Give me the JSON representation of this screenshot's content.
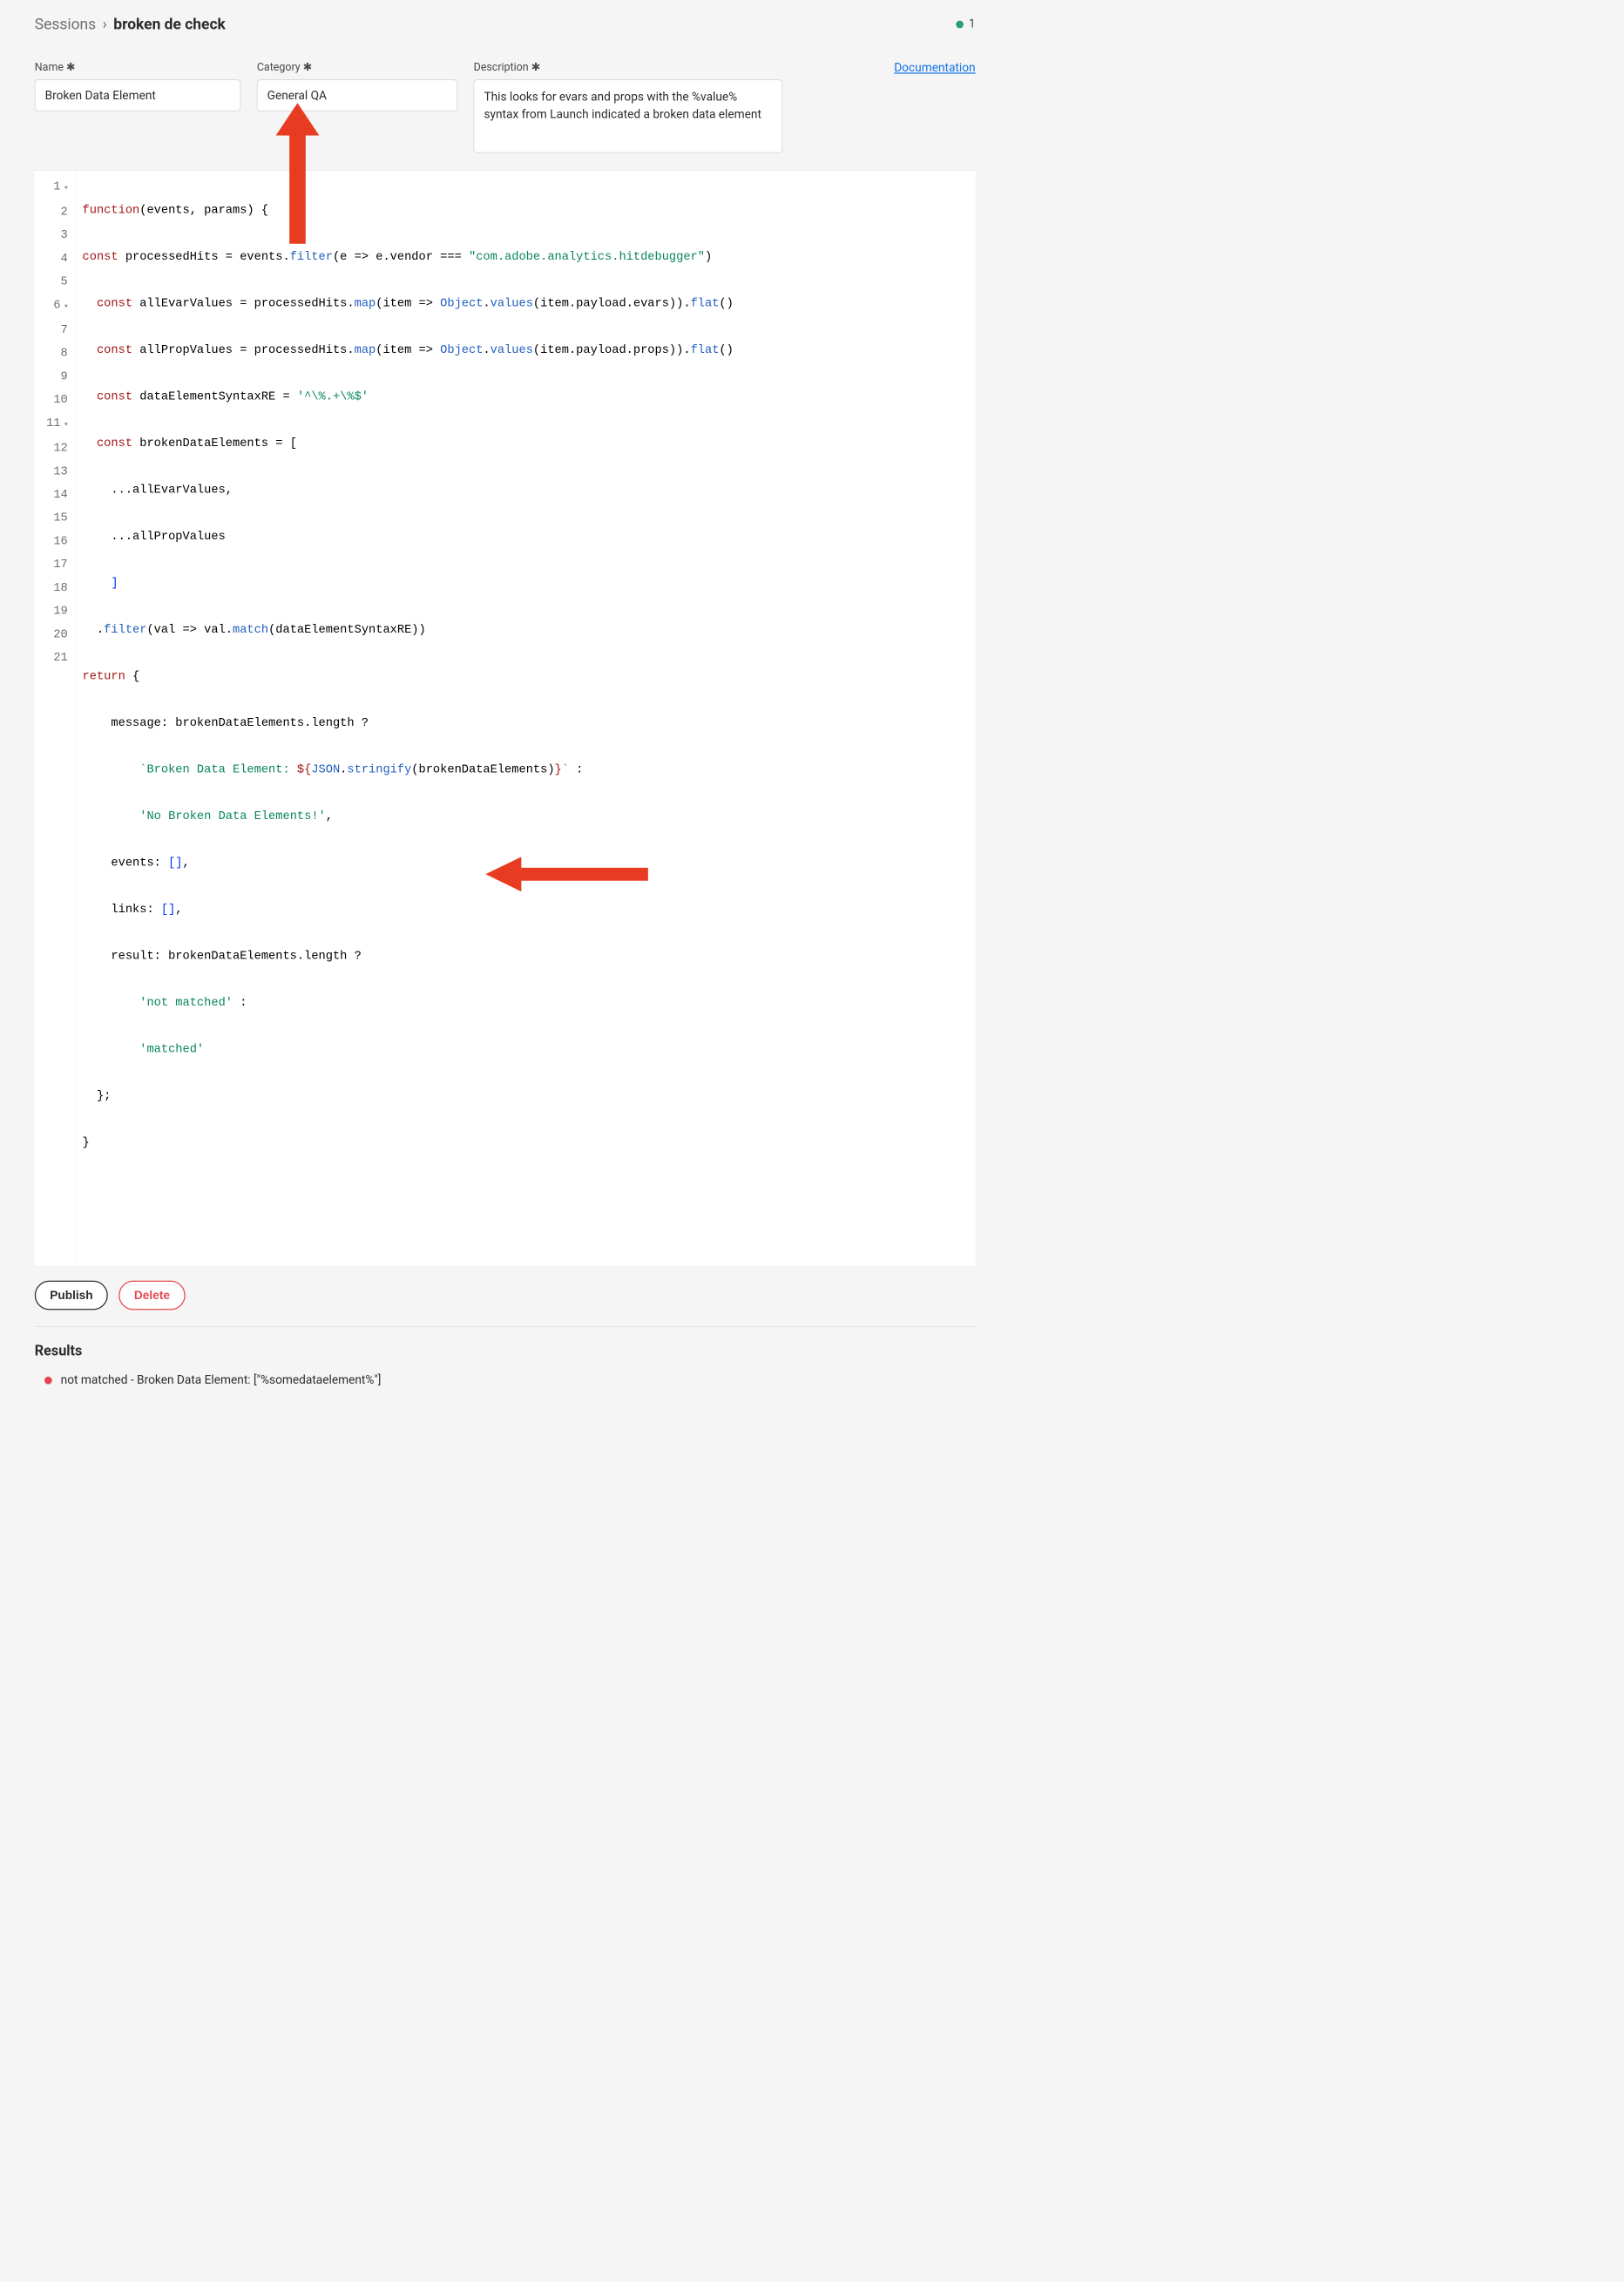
{
  "breadcrumb": {
    "root": "Sessions",
    "sep": "›",
    "current": "broken de check"
  },
  "status": {
    "count": "1"
  },
  "doc_link_label": "Documentation",
  "fields": {
    "name_label": "Name ✱",
    "name_value": "Broken Data Element",
    "category_label": "Category ✱",
    "category_value": "General QA",
    "description_label": "Description ✱",
    "description_value": "This looks for evars and props with the %value% syntax from Launch indicated a broken data element"
  },
  "code": {
    "l1": {
      "a": "function",
      "b": "(events, params) {"
    },
    "l2": {
      "a": "const",
      "b": " processedHits = events.",
      "c": "filter",
      "d": "(e => e.vendor === ",
      "e": "\"com.adobe.analytics.hitdebugger\"",
      "f": ")"
    },
    "l3": {
      "a": "  const",
      "b": " allEvarValues = processedHits.",
      "c": "map",
      "d": "(item => ",
      "e": "Object",
      "f": ".",
      "g": "values",
      "h": "(item.payload.evars)).",
      "i": "flat",
      "j": "()"
    },
    "l4": {
      "a": "  const",
      "b": " allPropValues = processedHits.",
      "c": "map",
      "d": "(item => ",
      "e": "Object",
      "f": ".",
      "g": "values",
      "h": "(item.payload.props)).",
      "i": "flat",
      "j": "()"
    },
    "l5": {
      "a": "  const",
      "b": " dataElementSyntaxRE = ",
      "c": "'^\\%.+\\%$'"
    },
    "l6": {
      "a": "  const",
      "b": " brokenDataElements = ["
    },
    "l7": "    ...allEvarValues,",
    "l8": "    ...allPropValues",
    "l9": "    ]",
    "l10": {
      "a": "  .",
      "b": "filter",
      "c": "(val => val.",
      "d": "match",
      "e": "(dataElementSyntaxRE))"
    },
    "l11": {
      "a": "return",
      "b": " {"
    },
    "l12": "    message: brokenDataElements.length ?",
    "l13": {
      "a": "        `Broken Data Element: ",
      "b": "${",
      "c": "JSON",
      "d": ".",
      "e": "stringify",
      "f": "(brokenDataElements)",
      "g": "}",
      "h": "`",
      "i": " :"
    },
    "l14": {
      "a": "        ",
      "b": "'No Broken Data Elements!'",
      "c": ","
    },
    "l15": {
      "a": "    events: ",
      "b": "[]",
      "c": ","
    },
    "l16": {
      "a": "    links: ",
      "b": "[]",
      "c": ","
    },
    "l17": "    result: brokenDataElements.length ?",
    "l18": {
      "a": "        ",
      "b": "'not matched'",
      "c": " :"
    },
    "l19": {
      "a": "        ",
      "b": "'matched'"
    },
    "l20": "  };",
    "l21": "}"
  },
  "buttons": {
    "publish": "Publish",
    "delete": "Delete"
  },
  "results": {
    "title": "Results",
    "line": "not matched - Broken Data Element: [\"%somedataelement%\"]"
  }
}
